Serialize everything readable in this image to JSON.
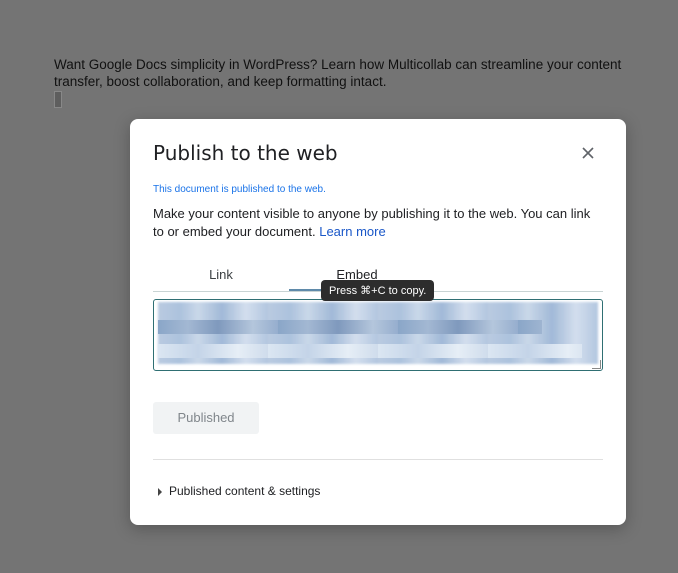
{
  "document": {
    "paragraph": "Want Google Docs simplicity in WordPress? Learn how Multicollab can streamline your content transfer, boost collaboration, and keep formatting intact."
  },
  "dialog": {
    "title": "Publish to the web",
    "close_icon": "close-icon",
    "status_message": "This document is published to the web.",
    "description": "Make your content visible to anyone by publishing it to the web. You can link to or embed your document.",
    "learn_more_label": "Learn more",
    "tabs": [
      {
        "label": "Link",
        "selected": false
      },
      {
        "label": "Embed",
        "selected": true
      }
    ],
    "tooltip": "Press ⌘+C to copy.",
    "embed_code_value": "",
    "published_button_label": "Published",
    "settings_toggle_label": "Published content & settings"
  },
  "colors": {
    "overlay": "#747474",
    "accent": "#1a73e8",
    "tab_indicator": "#5f8aaa"
  }
}
